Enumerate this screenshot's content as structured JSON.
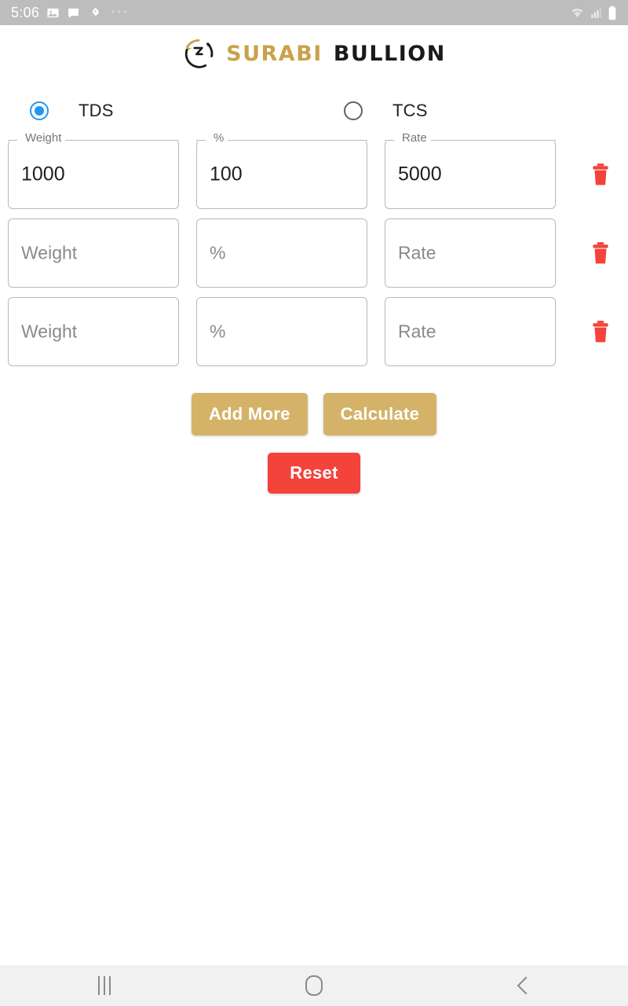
{
  "status_bar": {
    "time": "5:06",
    "left_icons": [
      "image-icon",
      "chat-icon",
      "rocket-icon"
    ],
    "overflow": "•••",
    "right_icons": [
      "wifi-icon",
      "cellular-signal-icon",
      "battery-icon"
    ],
    "background_color": "#bdbdbd"
  },
  "header": {
    "logo_mark": "circular-arrow-logo-icon",
    "brand_first": "SURABI",
    "brand_second": "BULLION",
    "brand_first_color": "#c9a24a",
    "brand_second_color": "#1a1a1a"
  },
  "tax_type": {
    "selected": "TDS",
    "options": [
      {
        "label": "TDS",
        "selected": true
      },
      {
        "label": "TCS",
        "selected": false
      }
    ],
    "accent_color": "#2196f3"
  },
  "rows": [
    {
      "weight": {
        "label": "Weight",
        "value": "1000",
        "placeholder": "Weight"
      },
      "percent": {
        "label": "%",
        "value": "100",
        "placeholder": "%"
      },
      "rate": {
        "label": "Rate",
        "value": "5000",
        "placeholder": "Rate"
      },
      "delete_icon": "trash-icon"
    },
    {
      "weight": {
        "label": "Weight",
        "value": "",
        "placeholder": "Weight"
      },
      "percent": {
        "label": "%",
        "value": "",
        "placeholder": "%"
      },
      "rate": {
        "label": "Rate",
        "value": "",
        "placeholder": "Rate"
      },
      "delete_icon": "trash-icon"
    },
    {
      "weight": {
        "label": "Weight",
        "value": "",
        "placeholder": "Weight"
      },
      "percent": {
        "label": "%",
        "value": "",
        "placeholder": "%"
      },
      "rate": {
        "label": "Rate",
        "value": "",
        "placeholder": "Rate"
      },
      "delete_icon": "trash-icon"
    }
  ],
  "actions": {
    "add_more": "Add More",
    "calculate": "Calculate",
    "reset": "Reset",
    "gold_color": "#d4b368",
    "red_color": "#f4433a"
  },
  "nav_bar": {
    "recents": "recents-icon",
    "home": "home-icon",
    "back": "back-icon"
  }
}
